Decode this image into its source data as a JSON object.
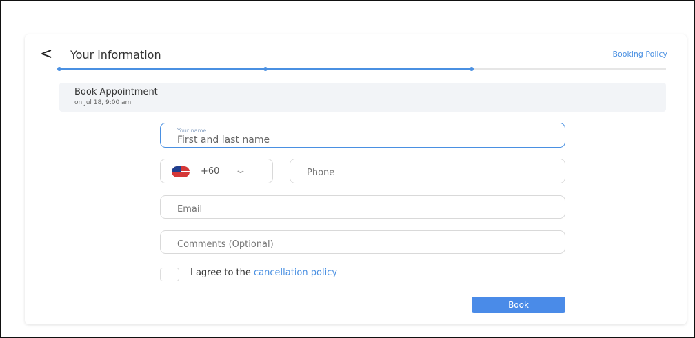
{
  "header": {
    "back_icon": "chevron-left-icon",
    "title": "Your information",
    "booking_policy": "Booking Policy"
  },
  "progress": {
    "fraction": 0.68,
    "steps": 3
  },
  "appointment": {
    "title": "Book Appointment",
    "subtitle": "on Jul 18, 9:00 am"
  },
  "form": {
    "name": {
      "label": "Your name",
      "placeholder": "First and last name"
    },
    "phone": {
      "country_code": "+60",
      "flag_icon": "malaysia-flag-icon",
      "placeholder": "Phone"
    },
    "email": {
      "placeholder": "Email"
    },
    "comments": {
      "placeholder": "Comments (Optional)"
    },
    "agree": {
      "prefix": "I agree to the",
      "link": "cancellation policy"
    },
    "submit_label": "Book"
  },
  "colors": {
    "accent": "#4a90e2",
    "button": "#4a8be8"
  }
}
